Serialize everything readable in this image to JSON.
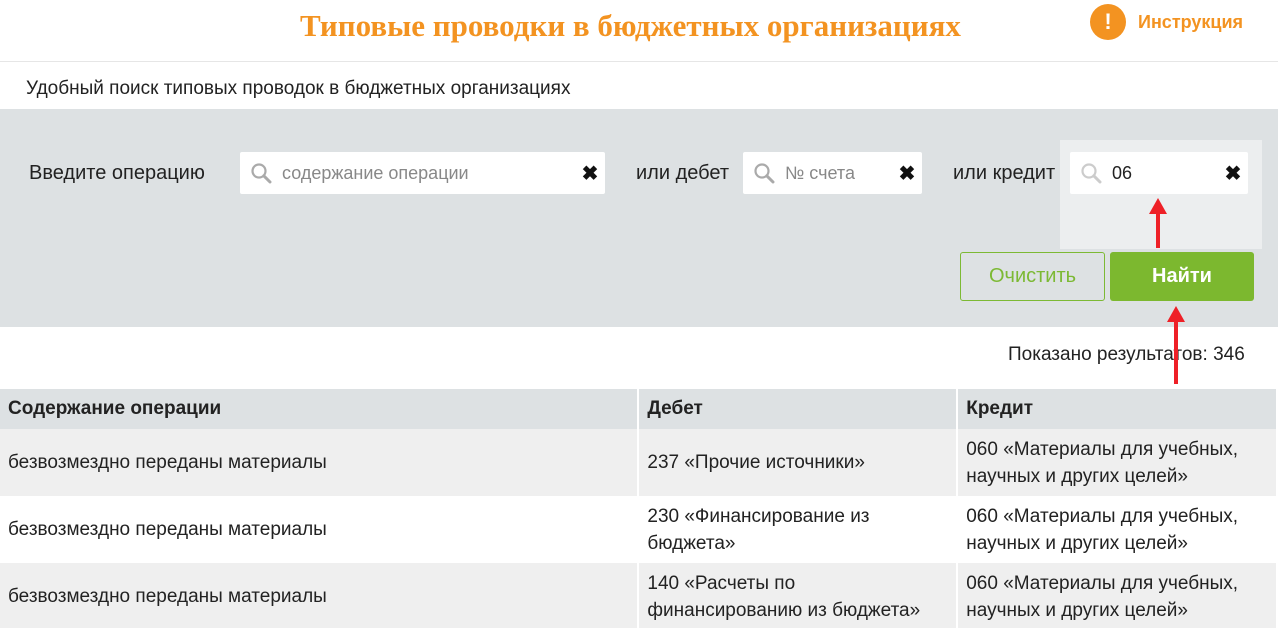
{
  "header": {
    "title": "Типовые проводки в бюджетных организациях",
    "instruction_label": "Инструкция",
    "instruction_icon": "exclamation-icon"
  },
  "subtitle": "Удобный поиск типовых проводок в бюджетных организациях",
  "search": {
    "operation_label": "Введите операцию",
    "operation_placeholder": "содержание операции",
    "operation_value": "",
    "debit_label": "или дебет",
    "debit_placeholder": "№ счета",
    "debit_value": "",
    "credit_label": "или кредит",
    "credit_value": "06",
    "clear_label": "Очистить",
    "find_label": "Найти"
  },
  "results_count": "Показано результатов: 346",
  "table": {
    "headers": [
      "Содержание операции",
      "Дебет",
      "Кредит"
    ],
    "rows": [
      [
        "безвозмездно переданы материалы",
        "237 «Прочие источники»",
        "060 «Материалы для учебных, научных и других целей»"
      ],
      [
        "безвозмездно переданы материалы",
        "230 «Финансирование из бюджета»",
        "060 «Материалы для учебных, научных и других целей»"
      ],
      [
        "безвозмездно переданы материалы",
        "140 «Расчеты по финансированию из бюджета»",
        "060 «Материалы для учебных, научных и других целей»"
      ]
    ]
  },
  "colors": {
    "accent_orange": "#f39321",
    "accent_green": "#7cb82f",
    "annotation_red": "#ee2027"
  }
}
